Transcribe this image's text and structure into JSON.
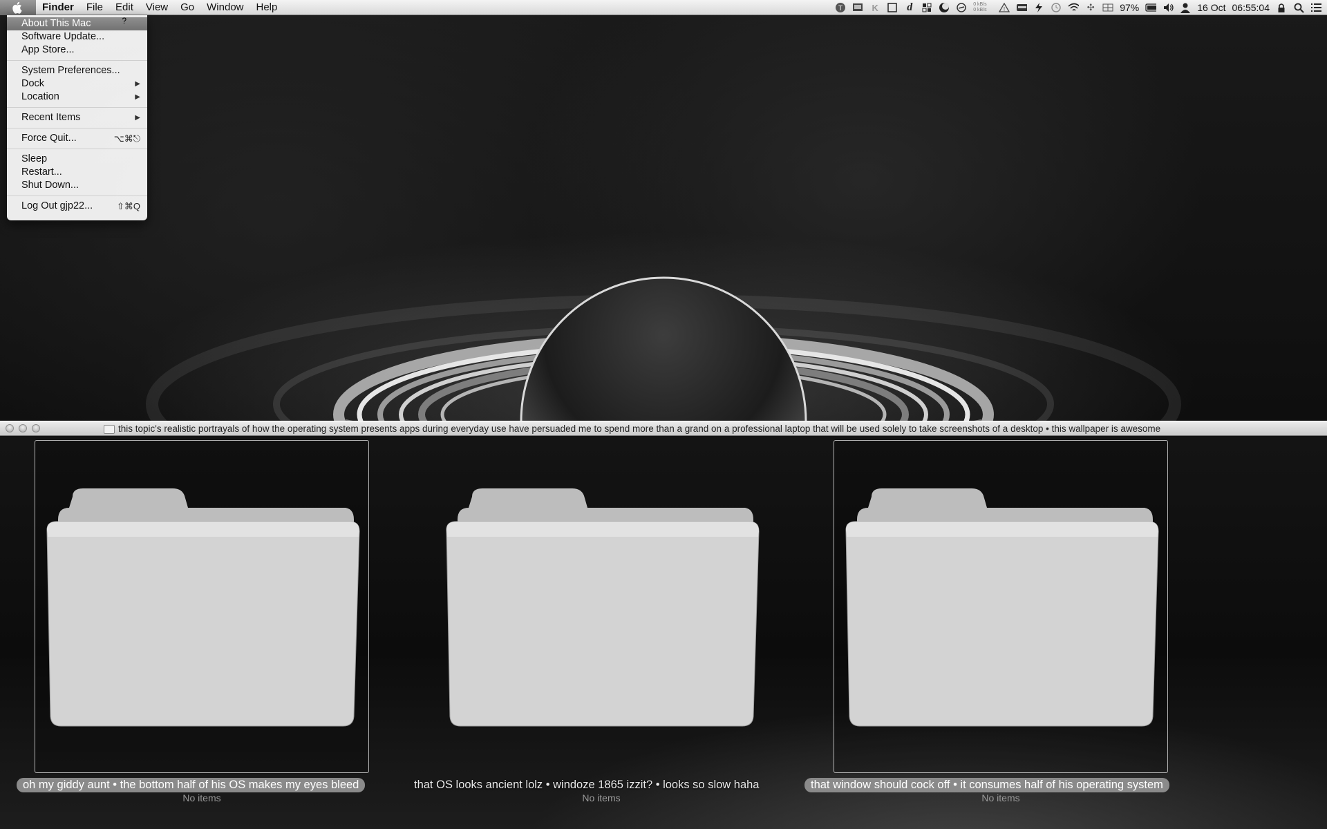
{
  "menubar": {
    "apple_icon": "apple-logo",
    "app_name": "Finder",
    "menus": [
      "File",
      "Edit",
      "View",
      "Go",
      "Window",
      "Help"
    ],
    "status_icons": [
      "typeit4me-icon",
      "screen-icon",
      "k-icon",
      "square-icon",
      "dictionary-icon",
      "grid-icon",
      "moon-icon",
      "circle-slash-icon",
      "network-meter-icon",
      "alert-icon",
      "keyboard-icon",
      "flash-icon",
      "time-machine-icon",
      "wifi-icon",
      "bluetooth-icon",
      "keyboard-layout-icon"
    ],
    "network_meter": [
      "0 kB/s",
      "0 kB/s"
    ],
    "battery_percent": "97%",
    "date": "16 Oct",
    "time": "06:55:04"
  },
  "apple_menu": {
    "items": [
      {
        "label": "About This Mac",
        "highlighted": true,
        "badge": "?"
      },
      {
        "label": "Software Update..."
      },
      {
        "label": "App Store..."
      },
      {
        "label": "System Preferences..."
      },
      {
        "label": "Dock",
        "submenu": "▶"
      },
      {
        "label": "Location",
        "submenu": "▶"
      },
      {
        "label": "Recent Items",
        "submenu": "▶"
      },
      {
        "label": "Force Quit...",
        "shortcut": "⌥⌘⎋"
      },
      {
        "label": "Sleep"
      },
      {
        "label": "Restart..."
      },
      {
        "label": "Shut Down..."
      },
      {
        "label": "Log Out gjp22...",
        "shortcut": "⇧⌘Q"
      }
    ]
  },
  "finder_window": {
    "title": "this topic's realistic portrayals of how the operating system presents apps during everyday use have persuaded me to spend more than a grand on a professional laptop that will be used solely to take screenshots of a desktop • this wallpaper is awesome",
    "items": [
      {
        "name": "oh my giddy aunt • the bottom half of his OS makes my eyes bleed",
        "info": "No items",
        "selected": true
      },
      {
        "name": "that OS looks ancient lolz • windoze 1865 izzit? • looks so slow haha",
        "info": "No items",
        "selected": false
      },
      {
        "name": "that window should cock off • it consumes half of his operating system",
        "info": "No items",
        "selected": true
      }
    ]
  },
  "colors": {
    "menubar": "#e4e4e4",
    "highlight": "#7f7f7f",
    "selection_label": "#8a8a8a"
  }
}
